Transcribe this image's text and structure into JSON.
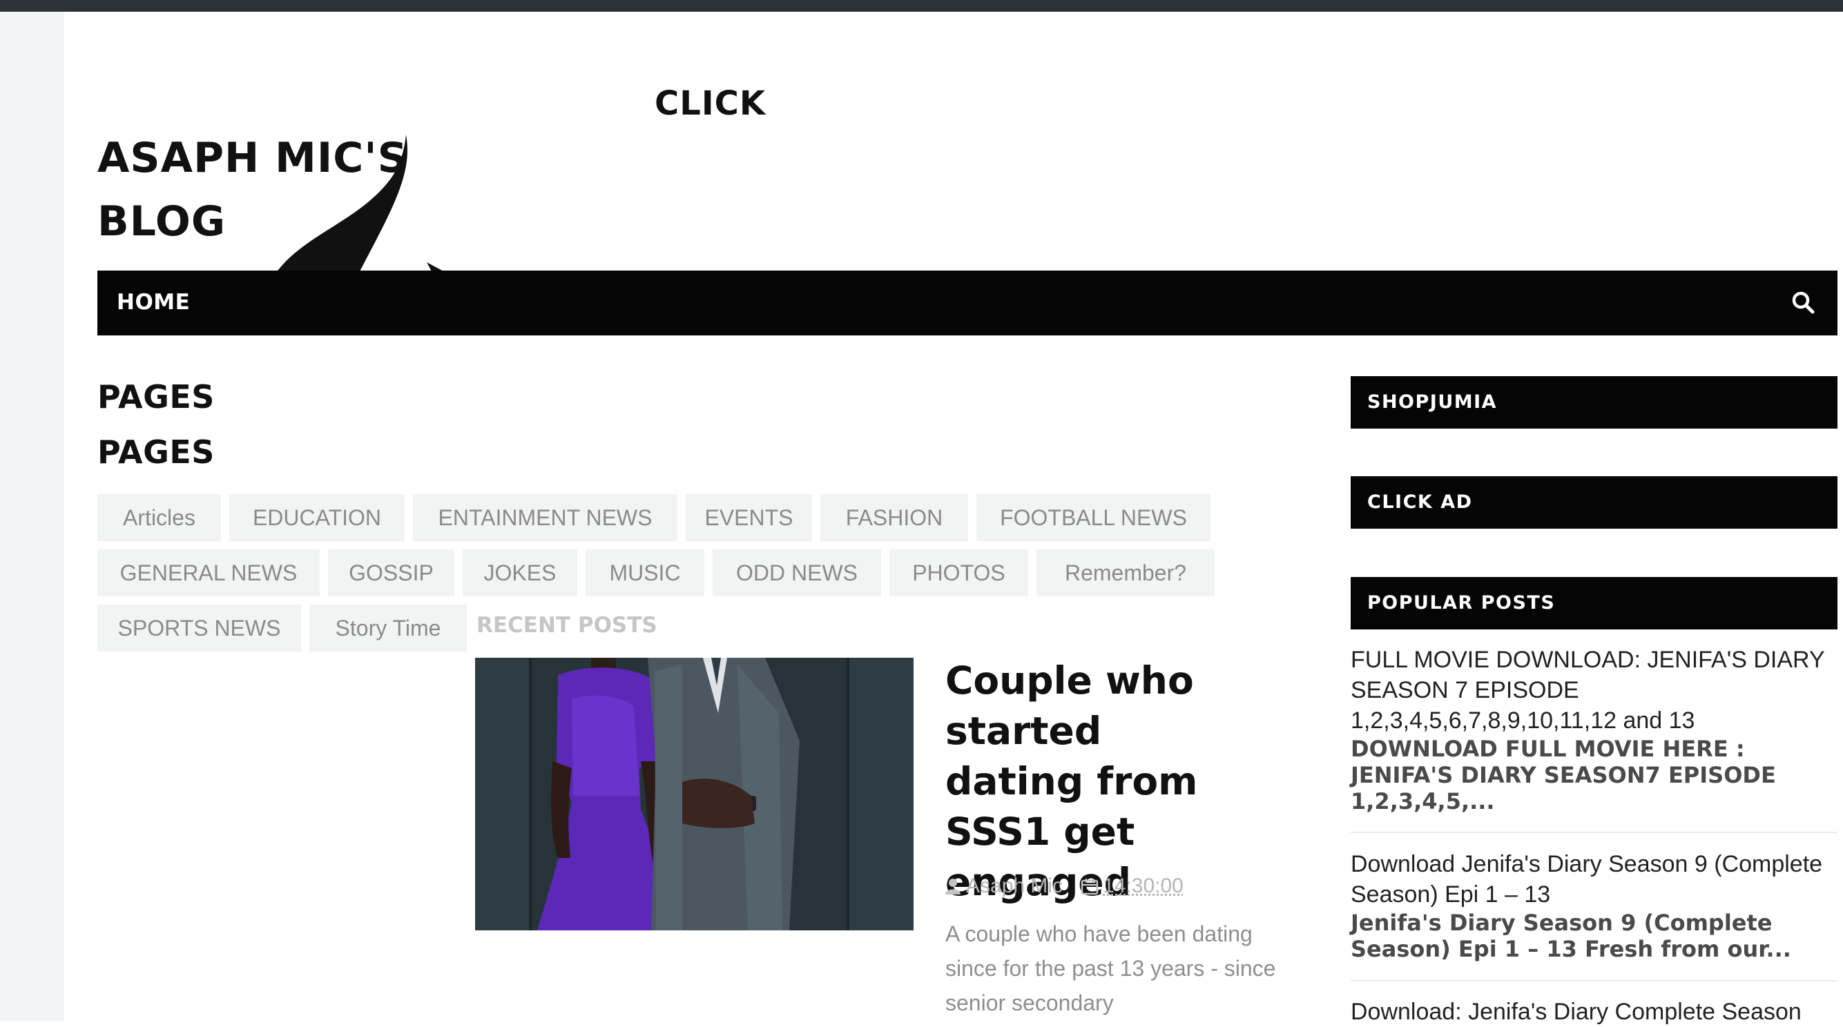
{
  "header": {
    "site_title_line1": "ASAPH MIC'S",
    "site_title_line2": "BLOG",
    "click_text": "CLICK"
  },
  "nav": {
    "home_label": "HOME",
    "search_icon": "search-icon"
  },
  "sections": {
    "pages_heading_1": "PAGES",
    "pages_heading_2": "PAGES",
    "recent_posts_label": "RECENT POSTS"
  },
  "categories": [
    "Articles",
    "EDUCATION",
    "ENTAINMENT NEWS",
    "EVENTS",
    "FASHION",
    "FOOTBALL NEWS",
    "GENERAL NEWS",
    "GOSSIP",
    "JOKES",
    "MUSIC",
    "ODD NEWS",
    "PHOTOS",
    "Remember?",
    "SPORTS NEWS",
    "Story Time"
  ],
  "featured_post": {
    "title": "Couple who started dating from SSS1 get engaged",
    "author": "Asaph Mic",
    "time": "14:30:00",
    "excerpt": "A couple who have been dating since for the past 13 years - since senior secondary"
  },
  "sidebar": {
    "shopjumia_heading": "SHOPJUMIA",
    "click_ad_heading": "CLICK AD",
    "popular_heading": "POPULAR POSTS",
    "popular_posts": [
      {
        "title": "FULL MOVIE DOWNLOAD: JENIFA'S DIARY SEASON 7 EPISODE 1,2,3,4,5,6,7,8,9,10,11,12 and 13",
        "snippet": "DOWNLOAD FULL MOVIE HERE : JENIFA'S DIARY SEASON7 EPISODE 1,2,3,4,5,..."
      },
      {
        "title": "Download Jenifa's Diary Season 9 (Complete Season) Epi 1 – 13",
        "snippet": "Jenifa's Diary Season 9 (Complete Season) Epi 1 – 13 Fresh from our..."
      },
      {
        "title": "Download: Jenifa's Diary Complete Season"
      }
    ]
  }
}
